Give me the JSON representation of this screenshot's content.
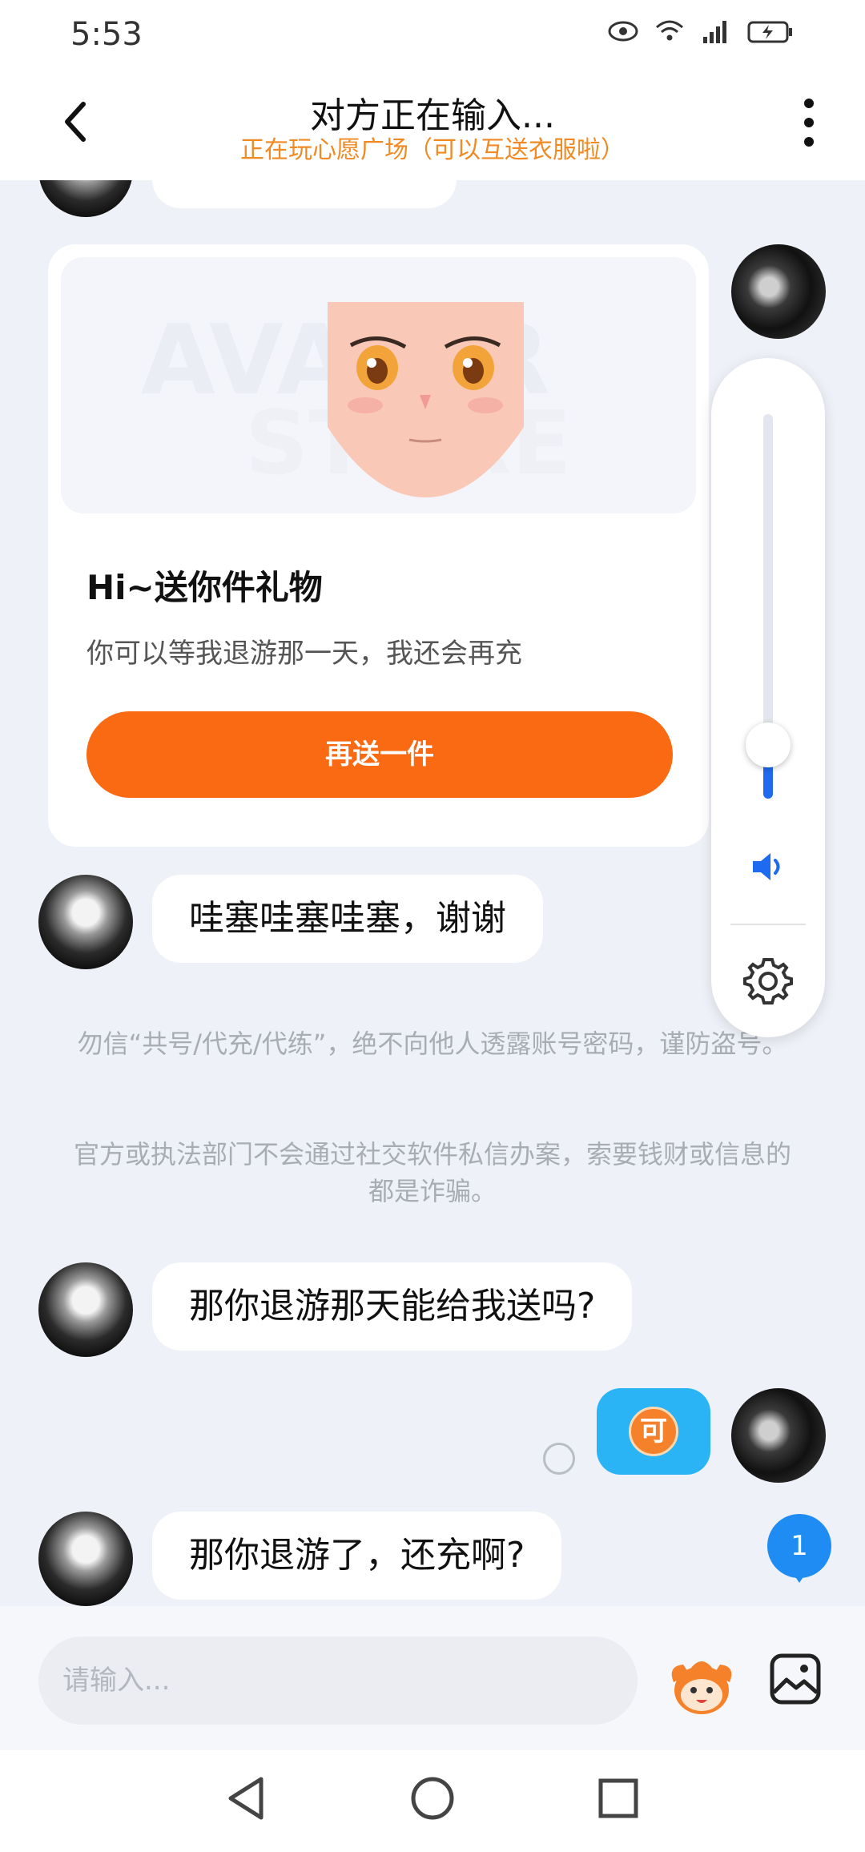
{
  "status_bar": {
    "time": "5:53"
  },
  "header": {
    "title": "对方正在输入...",
    "subtitle": "正在玩心愿广场（可以互送衣服啦）"
  },
  "gift_card": {
    "title": "Hi~送你件礼物",
    "description": "你可以等我退游那一天，我还会再充",
    "button_label": "再送一件"
  },
  "messages": [
    {
      "from": "other",
      "text": "哇塞哇塞哇塞，谢谢"
    },
    {
      "from": "other",
      "text": "那你退游那天能给我送吗?"
    },
    {
      "from": "me",
      "badge_text": "可"
    },
    {
      "from": "other",
      "text": "那你退游了，还充啊?"
    }
  ],
  "notices": [
    "勿信“共号/代充/代练”，绝不向他人透露账号密码，谨防盗号。",
    "官方或执法部门不会通过社交软件私信办案，索要钱财或信息的都是诈骗。"
  ],
  "volume": {
    "level": 0.14
  },
  "unread_count": "1",
  "input": {
    "placeholder": "请输入...",
    "value": ""
  },
  "icons": {
    "back": "back-arrow-icon",
    "more": "more-vertical-icon",
    "speaker": "speaker-icon",
    "settings": "gear-icon",
    "emoji": "emoji-mascot-icon",
    "image": "image-icon"
  },
  "colors": {
    "accent_orange": "#fa6a12",
    "subtitle_orange": "#f08a24",
    "my_bubble_blue": "#2ab4f5",
    "volume_blue": "#1f6bf0",
    "badge_blue": "#1e8cf2"
  }
}
